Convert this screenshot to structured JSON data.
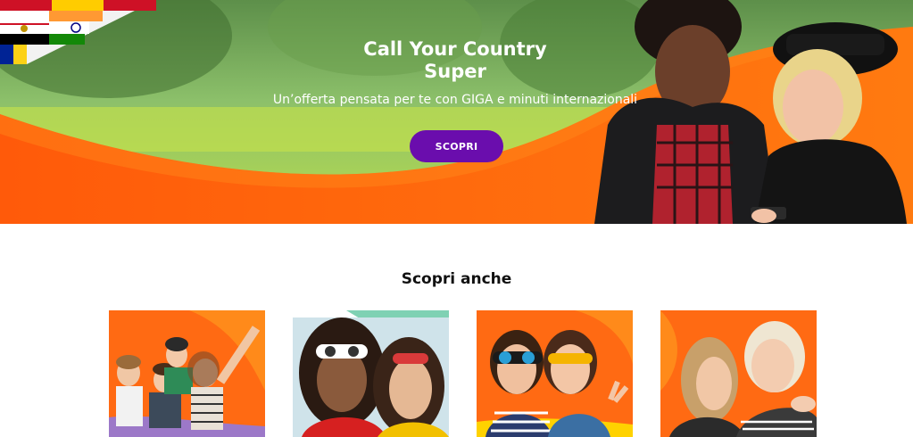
{
  "hero": {
    "title": "Call Your Country Super",
    "subtitle": "Un’offerta pensata per te con GIGA e minuti internazionali",
    "cta_label": "SCOPRI"
  },
  "section": {
    "title": "Scopri anche"
  },
  "cards": [
    {
      "image": "group-of-friends-photo"
    },
    {
      "image": "two-women-sunglasses-photo"
    },
    {
      "image": "two-women-selfie-photo"
    },
    {
      "image": "mother-daughter-photo"
    }
  ],
  "colors": {
    "brand_orange": "#ff6a13",
    "cta_purple": "#6a0dad"
  }
}
